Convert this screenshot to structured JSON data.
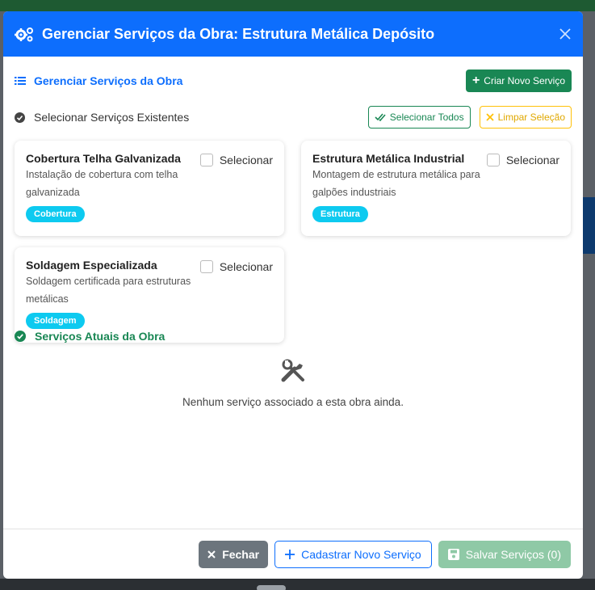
{
  "modal": {
    "title": "Gerenciar Serviços da Obra: Estrutura Metálica Depósito",
    "header_color": "#0d6efd"
  },
  "manage": {
    "section_title": "Gerenciar Serviços da Obra",
    "create_button": "Criar Novo Serviço"
  },
  "select": {
    "title": "Selecionar Serviços Existentes",
    "select_all": "Selecionar Todos",
    "clear": "Limpar Seleção"
  },
  "services": [
    {
      "name": "Cobertura Telha Galvanizada",
      "desc": "Instalação de cobertura com telha galvanizada",
      "badge": "Cobertura",
      "check_label": "Selecionar"
    },
    {
      "name": "Estrutura Metálica Industrial",
      "desc": "Montagem de estrutura metálica para galpões industriais",
      "badge": "Estrutura",
      "check_label": "Selecionar"
    },
    {
      "name": "Soldagem Especializada",
      "desc": "Soldagem certificada para estruturas metálicas",
      "badge": "Soldagem",
      "check_label": "Selecionar"
    }
  ],
  "current": {
    "title": "Serviços Atuais da Obra",
    "empty_text": "Nenhum serviço associado a esta obra ainda."
  },
  "footer": {
    "close": "Fechar",
    "register": "Cadastrar Novo Serviço",
    "save": "Salvar Serviços (0)"
  }
}
